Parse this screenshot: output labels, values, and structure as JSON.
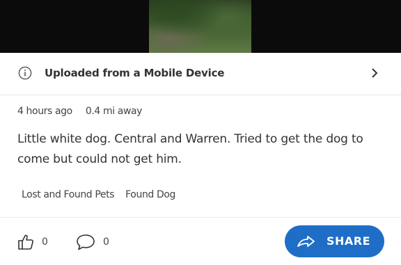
{
  "post": {
    "banner_text": "Uploaded from a Mobile Device",
    "time": "4 hours ago",
    "distance": "0.4 mi away",
    "description": "Little white dog. Central and Warren. Tried to get the dog to come but could not get him.",
    "tags": [
      "Lost and Found Pets",
      "Found Dog"
    ]
  },
  "actions": {
    "like_count": "0",
    "comment_count": "0",
    "share_label": "SHARE"
  },
  "icons": {
    "info": "info-circle-icon",
    "chevron": "chevron-right-icon",
    "like": "thumbs-up-icon",
    "comment": "speech-bubble-icon",
    "share": "share-arrow-icon"
  },
  "colors": {
    "share_button": "#1e6ec8",
    "media_background": "#0b0b0b"
  }
}
